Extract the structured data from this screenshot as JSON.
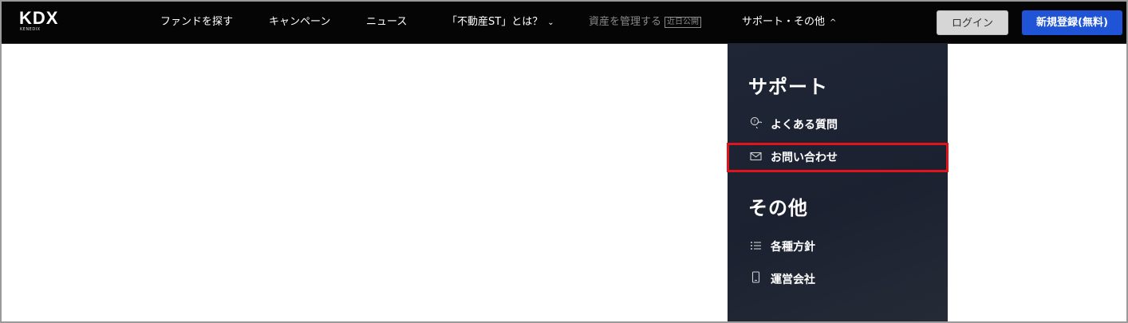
{
  "header": {
    "logo_text": "KDX",
    "logo_subtext": "KENEDIX",
    "nav": {
      "find_funds": "ファンドを探す",
      "campaign": "キャンペーン",
      "news": "ニュース",
      "about_st": "「不動産ST」とは？",
      "about_st_chevron": "⌄",
      "manage_assets": "資産を管理する",
      "manage_assets_badge": "近日公開",
      "support_other": "サポート・その他",
      "support_other_chevron": "^"
    },
    "login_label": "ログイン",
    "register_label": "新規登録(無料)"
  },
  "dropdown": {
    "support_heading": "サポート",
    "support_items": [
      {
        "label": "よくある質問",
        "icon": "faq-chat-icon"
      },
      {
        "label": "お問い合わせ",
        "icon": "mail-icon"
      }
    ],
    "other_heading": "その他",
    "other_items": [
      {
        "label": "各種方針",
        "icon": "list-icon"
      },
      {
        "label": "運営会社",
        "icon": "phone-building-icon"
      }
    ]
  },
  "colors": {
    "navbar_bg": "#050505",
    "dropdown_bg": "#1f2636",
    "register_button": "#1f54d6",
    "login_button": "#d6d6d6",
    "highlight": "#e0141a"
  }
}
